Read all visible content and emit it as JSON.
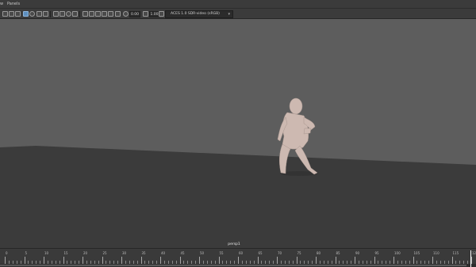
{
  "menubar": {
    "items": [
      {
        "id": "view",
        "label": "w"
      },
      {
        "id": "panels",
        "label": "Panels"
      }
    ]
  },
  "toolbar": {
    "icons": [
      "camera-select-icon",
      "camera-attributes-icon",
      "bookmark-icon",
      "image-plane-icon",
      "grid-icon",
      "film-gate-icon",
      "resolution-gate-icon",
      "wireframe-icon",
      "smooth-shade-icon",
      "default-material-icon",
      "xray-icon",
      "use-lights-icon",
      "shadows-icon",
      "ambient-occlusion-icon",
      "isolate-select-icon",
      "xray-joints-icon",
      "backface-culling-icon",
      "exposure-icon",
      "gamma-icon",
      "color-management-icon"
    ],
    "exposure": "0.00",
    "gamma": "1.00",
    "color_space": "ACES 1.0 SDR-video (sRGB)",
    "colors": {
      "active": "#5d8fbf",
      "bg": "#3b3b3b"
    }
  },
  "viewport": {
    "camera": "persp1",
    "colors": {
      "background": "#5d5d5d",
      "ground": "#3b3b3b",
      "figure": "#cdb9b1"
    }
  },
  "timeline": {
    "ticks": [
      "0",
      "5",
      "10",
      "15",
      "20",
      "25",
      "30",
      "35",
      "40",
      "45",
      "50",
      "55",
      "60",
      "65",
      "70",
      "75",
      "80",
      "85",
      "90",
      "95",
      "100",
      "105",
      "110",
      "115",
      "120"
    ],
    "current_frame": 120,
    "colors": {
      "key": "#d64b4b"
    }
  }
}
